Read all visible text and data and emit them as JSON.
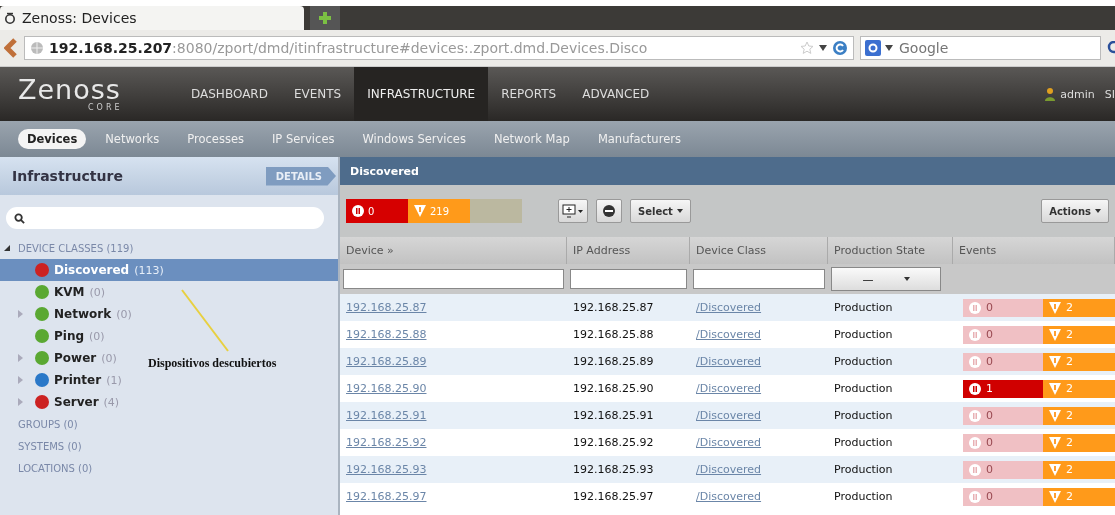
{
  "browser": {
    "tab_title": "Zenoss: Devices",
    "url": "**192.168.25.207**:8080/zport/dmd/itinfrastructure#devices:.zport.dmd.Devices.Disco",
    "search": {
      "placeholder": "Google"
    }
  },
  "app": {
    "logo": "Zenoss",
    "logo_sub": "CORE",
    "nav": [
      {
        "label": "DASHBOARD",
        "selected": false
      },
      {
        "label": "EVENTS",
        "selected": false
      },
      {
        "label": "INFRASTRUCTURE",
        "selected": true
      },
      {
        "label": "REPORTS",
        "selected": false
      },
      {
        "label": "ADVANCED",
        "selected": false
      }
    ],
    "user": "admin",
    "sign_out": "SI",
    "subnav": [
      {
        "label": "Devices",
        "selected": true
      },
      {
        "label": "Networks",
        "selected": false
      },
      {
        "label": "Processes",
        "selected": false
      },
      {
        "label": "IP Services",
        "selected": false
      },
      {
        "label": "Windows Services",
        "selected": false
      },
      {
        "label": "Network Map",
        "selected": false
      },
      {
        "label": "Manufacturers",
        "selected": false
      }
    ]
  },
  "sidebar": {
    "title": "Infrastructure",
    "details_button": "DETAILS",
    "tree": [
      {
        "label": "DEVICE CLASSES",
        "count": "(119)",
        "expanded": true,
        "children": [
          {
            "label": "Discovered",
            "count": "(113)",
            "color": "#cc2222",
            "selected": true,
            "has_children": false
          },
          {
            "label": "KVM",
            "count": "(0)",
            "color": "#5aa832",
            "selected": false,
            "has_children": false
          },
          {
            "label": "Network",
            "count": "(0)",
            "color": "#5aa832",
            "selected": false,
            "has_children": true
          },
          {
            "label": "Ping",
            "count": "(0)",
            "color": "#5aa832",
            "selected": false,
            "has_children": false
          },
          {
            "label": "Power",
            "count": "(0)",
            "color": "#5aa832",
            "selected": false,
            "has_children": true
          },
          {
            "label": "Printer",
            "count": "(1)",
            "color": "#2a78c8",
            "selected": false,
            "has_children": true
          },
          {
            "label": "Server",
            "count": "(4)",
            "color": "#cc2222",
            "selected": false,
            "has_children": true
          }
        ]
      },
      {
        "label": "GROUPS",
        "count": "(0)",
        "expanded": false
      },
      {
        "label": "SYSTEMS",
        "count": "(0)",
        "expanded": false
      },
      {
        "label": "LOCATIONS",
        "count": "(0)",
        "expanded": false
      }
    ]
  },
  "annotation": "Dispositivos descubiertos",
  "main": {
    "title": "Discovered",
    "critical_total": "0",
    "warning_total": "219",
    "select_button": "Select",
    "actions_button": "Actions",
    "columns": [
      "Device »",
      "IP Address",
      "Device Class",
      "Production State",
      "Events"
    ],
    "production_filter": "—",
    "rows": [
      {
        "device": "192.168.25.87",
        "ip": "192.168.25.87",
        "device_class": "/Discovered",
        "state": "Production",
        "critical": "0",
        "critical_active": false,
        "warning": "2"
      },
      {
        "device": "192.168.25.88",
        "ip": "192.168.25.88",
        "device_class": "/Discovered",
        "state": "Production",
        "critical": "0",
        "critical_active": false,
        "warning": "2"
      },
      {
        "device": "192.168.25.89",
        "ip": "192.168.25.89",
        "device_class": "/Discovered",
        "state": "Production",
        "critical": "0",
        "critical_active": false,
        "warning": "2"
      },
      {
        "device": "192.168.25.90",
        "ip": "192.168.25.90",
        "device_class": "/Discovered",
        "state": "Production",
        "critical": "1",
        "critical_active": true,
        "warning": "2"
      },
      {
        "device": "192.168.25.91",
        "ip": "192.168.25.91",
        "device_class": "/Discovered",
        "state": "Production",
        "critical": "0",
        "critical_active": false,
        "warning": "2"
      },
      {
        "device": "192.168.25.92",
        "ip": "192.168.25.92",
        "device_class": "/Discovered",
        "state": "Production",
        "critical": "0",
        "critical_active": false,
        "warning": "2"
      },
      {
        "device": "192.168.25.93",
        "ip": "192.168.25.93",
        "device_class": "/Discovered",
        "state": "Production",
        "critical": "0",
        "critical_active": false,
        "warning": "2"
      },
      {
        "device": "192.168.25.97",
        "ip": "192.168.25.97",
        "device_class": "/Discovered",
        "state": "Production",
        "critical": "0",
        "critical_active": false,
        "warning": "2"
      }
    ]
  }
}
